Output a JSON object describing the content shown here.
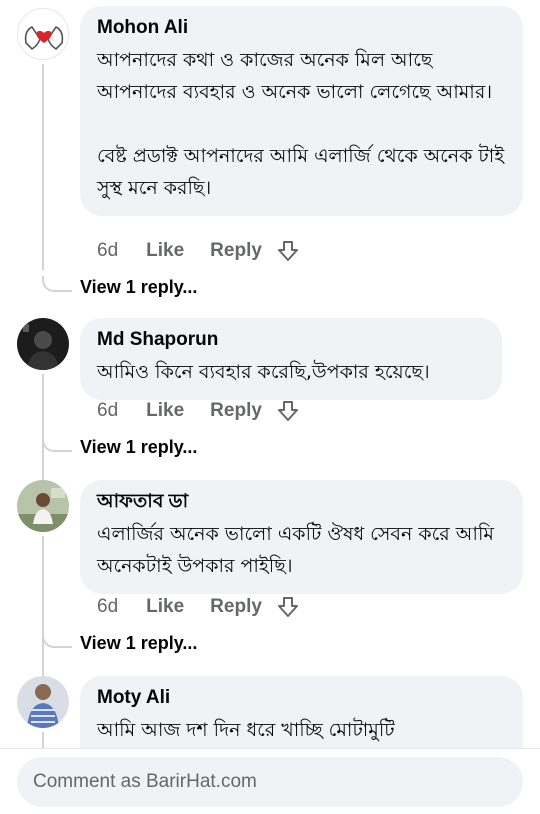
{
  "comments": [
    {
      "author": "Mohon Ali",
      "text": "আপনাদের কথা ও কাজের অনেক মিল আছে আপনাদের ব্যবহার ও অনেক ভালো লেগেছে আমার।\n\nবেষ্ট প্রডাক্ট আপনাদের আমি এলার্জি থেকে অনেক টাই সুস্থ মনে করছি।",
      "time": "6d",
      "like": "Like",
      "reply": "Reply",
      "view_replies": "View 1 reply...",
      "avatar_icon": "heart-hands-icon"
    },
    {
      "author": "Md Shaporun",
      "text": "আমিও কিনে ব্যবহার করেছি,উপকার হয়েছে।",
      "time": "6d",
      "like": "Like",
      "reply": "Reply",
      "view_replies": "View 1 reply...",
      "avatar_icon": "profile-photo"
    },
    {
      "author": "আফতাব ডা",
      "text": "এলার্জির অনেক ভালো একটি ঔষধ সেবন করে আমি অনেকটাই উপকার পাইছি।",
      "time": "6d",
      "like": "Like",
      "reply": "Reply",
      "view_replies": "View 1 reply...",
      "avatar_icon": "profile-photo"
    },
    {
      "author": "Moty Ali",
      "text": "আমি আজ দশ দিন ধরে খাচ্ছি মোটামুটি",
      "avatar_icon": "profile-photo"
    }
  ],
  "footer": {
    "placeholder": "Comment as BarirHat.com"
  },
  "colors": {
    "bubble": "#f0f2f5",
    "meta": "#65676b",
    "thread_line": "#d0d3d8"
  }
}
